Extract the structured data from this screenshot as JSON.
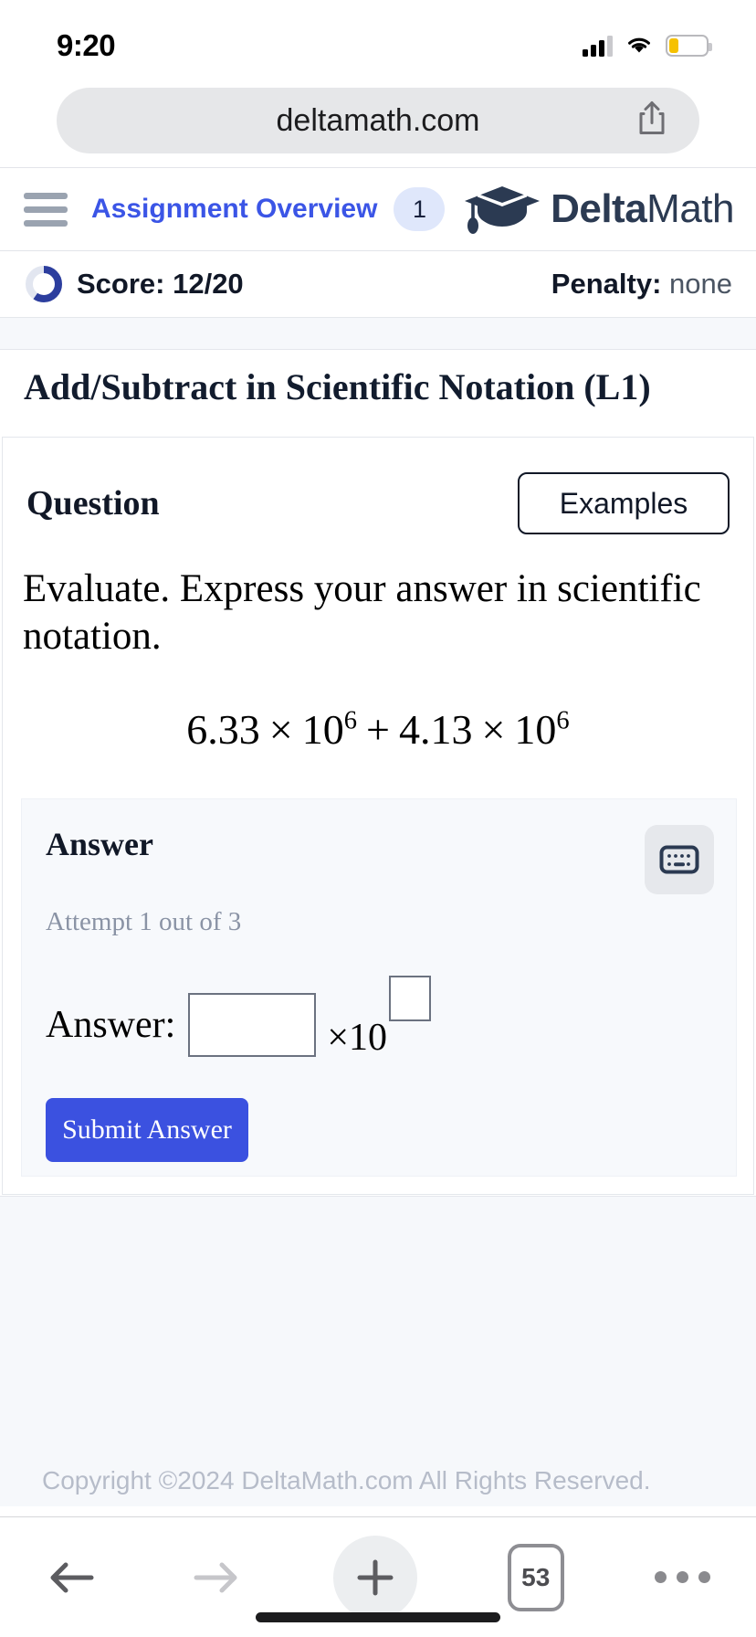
{
  "status_bar": {
    "time": "9:20",
    "cellular_icon": "cellular-signal-icon",
    "wifi_icon": "wifi-icon",
    "battery_icon": "battery-low-icon"
  },
  "browser": {
    "url": "deltamath.com",
    "share_icon": "share-icon",
    "toolbar": {
      "back_icon": "back-arrow-icon",
      "forward_icon": "forward-arrow-icon",
      "new_tab_icon": "plus-icon",
      "tab_count": "53",
      "more_icon": "more-dots-icon"
    }
  },
  "nav": {
    "menu_icon": "hamburger-menu-icon",
    "link_label": "Assignment Overview",
    "badge_count": "1",
    "brand_bold": "Delta",
    "brand_light": "Math",
    "brand_icon": "graduation-cap-icon"
  },
  "status_strip": {
    "progress_icon": "score-donut-icon",
    "score_label": "Score: 12/20",
    "penalty_label": "Penalty:",
    "penalty_value": "none"
  },
  "problem": {
    "title": "Add/Subtract in Scientific Notation (L1)",
    "question_heading": "Question",
    "examples_button": "Examples",
    "prompt": "Evaluate. Express your answer in scientific notation.",
    "expression": {
      "a_mantissa": "6.33",
      "a_times": "×",
      "a_base": "10",
      "a_exponent": "6",
      "operator": "+",
      "b_mantissa": "4.13",
      "b_times": "×",
      "b_base": "10",
      "b_exponent": "6"
    }
  },
  "answer": {
    "heading": "Answer",
    "attempt_text": "Attempt 1 out of 3",
    "keyboard_icon": "keyboard-icon",
    "answer_label": "Answer:",
    "mantissa_value": "",
    "mantissa_placeholder": "",
    "times_base": "×10",
    "exponent_value": "",
    "exponent_placeholder": "",
    "submit_label": "Submit Answer"
  },
  "footer": {
    "copyright": "Copyright ©2024 DeltaMath.com All Rights Reserved."
  },
  "colors": {
    "accent_blue": "#3b51e0",
    "link_blue": "#3b55e6",
    "brand_navy": "#2b3a52",
    "panel_bg": "#f7f9fc",
    "battery_yellow": "#f6c100"
  }
}
